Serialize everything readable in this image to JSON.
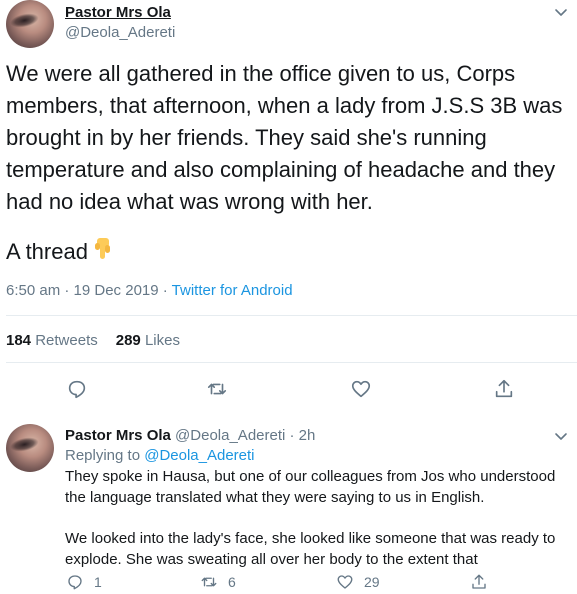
{
  "main_tweet": {
    "display_name": "Pastor Mrs Ola",
    "handle": "@Deola_Adereti",
    "body": "We were all gathered in the office given to us, Corps members, that afternoon, when a lady from J.S.S 3B was brought in by her friends. They said she's running temperature  and also complaining of headache and they had no idea what was wrong with her.",
    "thread_label": "A thread",
    "thread_emoji": "pointing-down-emoji",
    "timestamp": "6:50 am · 19 Dec 2019 · ",
    "source": "Twitter for Android",
    "retweets_count": "184",
    "retweets_label": "Retweets",
    "likes_count": "289",
    "likes_label": "Likes",
    "actions": [
      "reply-icon",
      "retweet-icon",
      "like-icon",
      "share-icon"
    ]
  },
  "reply_tweet": {
    "display_name": "Pastor Mrs Ola",
    "handle_and_time": "@Deola_Adereti · 2h",
    "replying_prefix": "Replying to ",
    "replying_handle": "@Deola_Adereti",
    "paragraph1": "They spoke in Hausa, but one of our colleagues from Jos who understood the language translated what they were saying to us in English.",
    "paragraph2": "We looked into the lady's face, she looked like someone that was ready to explode. She was sweating all over her body to the extent that",
    "reply_count": "1",
    "retweet_count": "6",
    "like_count": "29"
  },
  "colors": {
    "text": "#14171a",
    "secondary": "#657786",
    "link": "#1b95e0",
    "divider": "#e6ecf0",
    "icon": "#657786"
  }
}
